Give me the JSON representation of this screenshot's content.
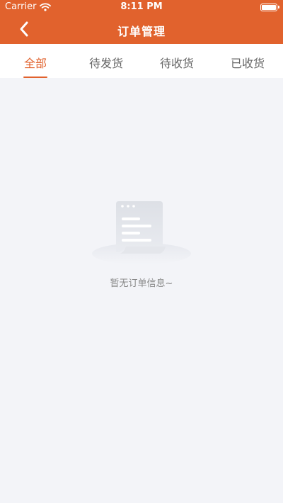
{
  "status_bar": {
    "carrier": "Carrier",
    "time": "8:11 PM"
  },
  "nav": {
    "title": "订单管理",
    "back_icon": "chevron-left-icon"
  },
  "tabs": [
    {
      "label": "全部",
      "active": true
    },
    {
      "label": "待发货",
      "active": false
    },
    {
      "label": "待收货",
      "active": false
    },
    {
      "label": "已收货",
      "active": false
    }
  ],
  "empty_state": {
    "message": "暂无订单信息~",
    "icon": "empty-document-icon"
  },
  "colors": {
    "accent": "#e1622d",
    "background": "#f3f4f8",
    "tab_inactive": "#666666",
    "empty_text": "#888888"
  }
}
